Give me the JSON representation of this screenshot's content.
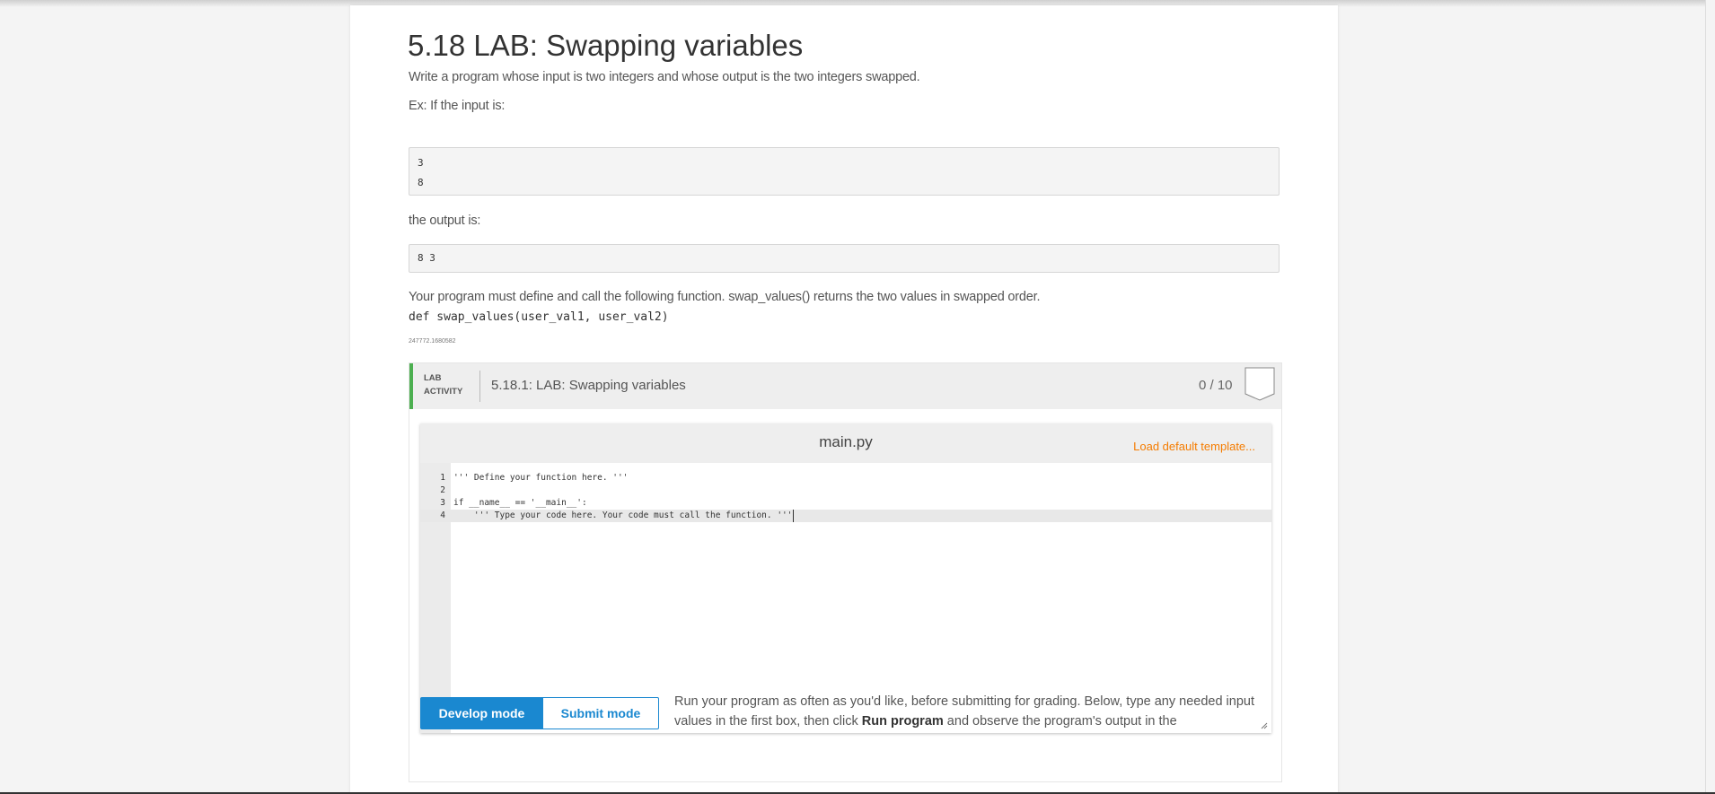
{
  "title": "5.18 LAB: Swapping variables",
  "description": "Write a program whose input is two integers and whose output is the two integers swapped.",
  "example_label": "Ex: If the input is:",
  "example_input": [
    "3",
    "8"
  ],
  "output_label": "the output is:",
  "example_output": "8 3",
  "function_note": "Your program must define and call the following function. swap_values() returns the two values in swapped order.",
  "function_signature": "def swap_values(user_val1, user_val2)",
  "lab_id": "247772.1680582",
  "lab": {
    "tag_line1": "LAB",
    "tag_line2": "ACTIVITY",
    "title": "5.18.1: LAB: Swapping variables",
    "score": "0 / 10",
    "filename": "main.py",
    "load_default": "Load default template...",
    "code_lines": [
      {
        "num": "1",
        "text": "''' Define your function here. '''"
      },
      {
        "num": "2",
        "text": ""
      },
      {
        "num": "3",
        "text": "if __name__ == '__main__':"
      },
      {
        "num": "4",
        "text": "    ''' Type your code here. Your code must call the function. '''"
      }
    ],
    "develop_mode": "Develop mode",
    "submit_mode": "Submit mode",
    "info_part1": "Run your program as often as you'd like, before submitting for grading. Below, type any needed input values in the first box, then click ",
    "info_bold": "Run program",
    "info_part2": " and observe the program's output in the"
  },
  "colors": {
    "accent": "#1a88d0",
    "green": "#4caf50",
    "orange": "#f57c00"
  }
}
